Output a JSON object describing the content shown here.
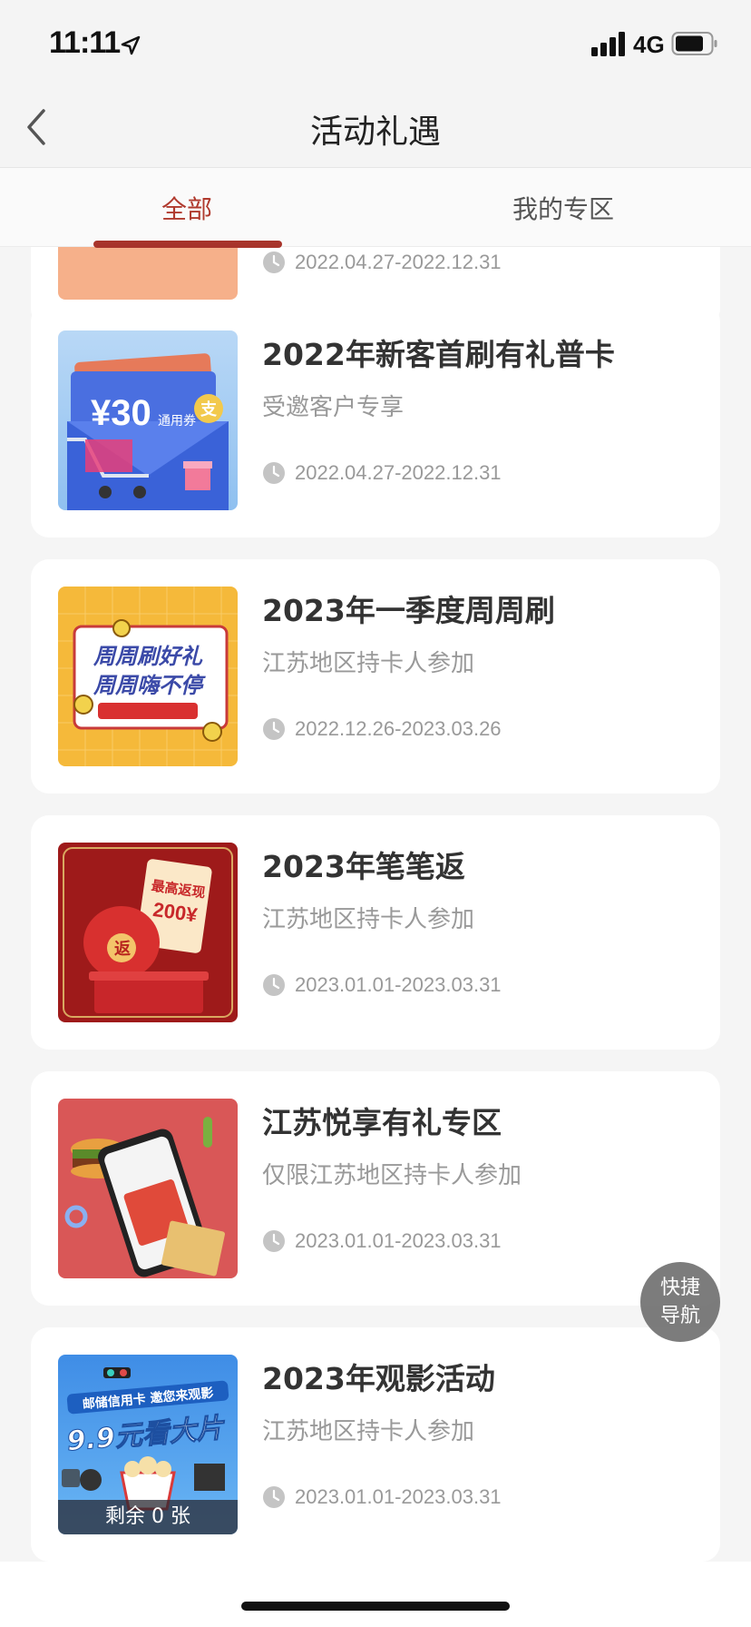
{
  "status_bar": {
    "time": "11:11",
    "network": "4G"
  },
  "nav": {
    "title": "活动礼遇"
  },
  "tabs": [
    {
      "label": "全部",
      "active": true
    },
    {
      "label": "我的专区",
      "active": false
    }
  ],
  "colors": {
    "accent": "#a8342b",
    "active_tab_text": "#b03a2e"
  },
  "partial_card": {
    "date": "2022.04.27-2022.12.31"
  },
  "cards": [
    {
      "title": "2022年新客首刷有礼普卡",
      "subtitle": "受邀客户专享",
      "date": "2022.04.27-2022.12.31",
      "thumb_text": {
        "amount": "¥30",
        "coupon": "通用券",
        "badge": "支"
      }
    },
    {
      "title": "2023年一季度周周刷",
      "subtitle": "江苏地区持卡人参加",
      "date": "2022.12.26-2023.03.26",
      "thumb_text": {
        "line1": "周周刷好礼",
        "line2": "周周嗨不停"
      }
    },
    {
      "title": "2023年笔笔返",
      "subtitle": "江苏地区持卡人参加",
      "date": "2023.01.01-2023.03.31",
      "thumb_text": {
        "line1": "最高返现",
        "line2": "200¥",
        "bag": "返"
      }
    },
    {
      "title": "江苏悦享有礼专区",
      "subtitle": "仅限江苏地区持卡人参加",
      "date": "2023.01.01-2023.03.31"
    },
    {
      "title": "2023年观影活动",
      "subtitle": "江苏地区持卡人参加",
      "date": "2023.01.01-2023.03.31",
      "remaining": "剩余 0 张",
      "thumb_text": {
        "line1": "邮储信用卡 邀您来观影",
        "line2": "9.9元看大片"
      }
    }
  ],
  "quick_nav": {
    "line1": "快捷",
    "line2": "导航"
  }
}
